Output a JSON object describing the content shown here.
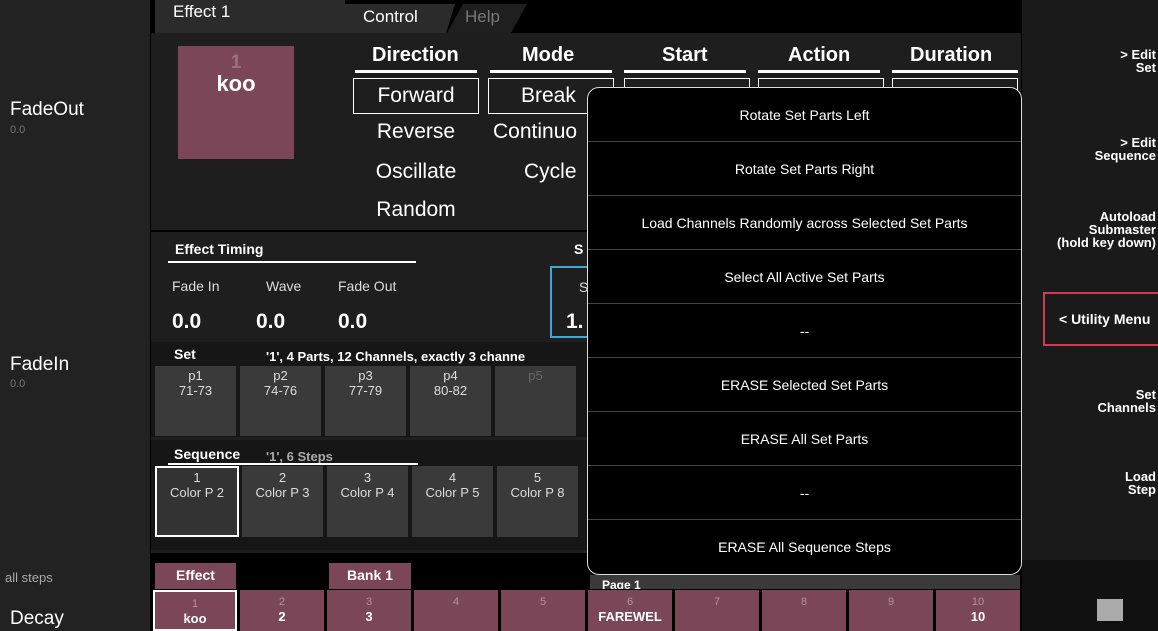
{
  "left": {
    "fadeout_label": "FadeOut",
    "fadeout_value": "0.0",
    "fadein_label": "FadeIn",
    "fadein_value": "0.0",
    "all_steps_label": "all steps",
    "decay_label": "Decay"
  },
  "tabs": {
    "effect": "Effect 1",
    "control": "Control",
    "help": "Help"
  },
  "effect_tile": {
    "number": "1",
    "name": "koo"
  },
  "columns": {
    "direction": "Direction",
    "mode": "Mode",
    "start": "Start",
    "action": "Action",
    "duration": "Duration"
  },
  "direction_options": [
    "Forward",
    "Reverse",
    "Oscillate",
    "Random"
  ],
  "mode_options": [
    "Break",
    "Continuo",
    "Cycle"
  ],
  "timing": {
    "title": "Effect Timing",
    "fade_in_label": "Fade In",
    "wave_label": "Wave",
    "fade_out_label": "Fade Out",
    "fade_in": "0.0",
    "wave": "0.0",
    "fade_out": "0.0",
    "s_title": "S",
    "s_label": "S",
    "s_value": "1."
  },
  "set": {
    "title": "Set",
    "info": "'1', 4 Parts, 12 Channels, exactly 3 channe",
    "parts": [
      {
        "name": "p1",
        "range": "71-73"
      },
      {
        "name": "p2",
        "range": "74-76"
      },
      {
        "name": "p3",
        "range": "77-79"
      },
      {
        "name": "p4",
        "range": "80-82"
      },
      {
        "name": "p5",
        "range": ""
      }
    ]
  },
  "sequence": {
    "title": "Sequence",
    "info": "'1', 6 Steps",
    "steps": [
      {
        "n": "1",
        "label": "Color P 2"
      },
      {
        "n": "2",
        "label": "Color P 3"
      },
      {
        "n": "3",
        "label": "Color P 4"
      },
      {
        "n": "4",
        "label": "Color P 5"
      },
      {
        "n": "5",
        "label": "Color P 8"
      }
    ]
  },
  "bottom": {
    "effect_tab": "Effect",
    "bank_tab": "Bank 1",
    "page_tab": "Page 1",
    "bank": [
      {
        "n": "1",
        "v": "koo"
      },
      {
        "n": "2",
        "v": "2"
      },
      {
        "n": "3",
        "v": "3"
      },
      {
        "n": "4",
        "v": ""
      },
      {
        "n": "5",
        "v": ""
      },
      {
        "n": "6",
        "v": "FAREWEL"
      },
      {
        "n": "7",
        "v": ""
      },
      {
        "n": "8",
        "v": ""
      },
      {
        "n": "9",
        "v": ""
      },
      {
        "n": "10",
        "v": "10"
      }
    ]
  },
  "right": {
    "edit_set": "> Edit\nSet",
    "edit_sequence": "> Edit\nSequence",
    "autoload": "Autoload\nSubmaster\n(hold key down)",
    "utility_menu": "< Utility Menu",
    "set_channels": "Set\nChannels",
    "load_step": "Load\nStep"
  },
  "popup": {
    "items": [
      "Rotate Set Parts Left",
      "Rotate Set Parts Right",
      "Load Channels Randomly across Selected Set Parts",
      "Select All Active Set Parts",
      "--",
      "ERASE Selected Set Parts",
      "ERASE All Set Parts",
      "--",
      "ERASE All Sequence Steps"
    ]
  },
  "colors": {
    "accent": "#7b4658",
    "highlight": "#d23c50",
    "selected_blue": "#3fa9d6"
  }
}
